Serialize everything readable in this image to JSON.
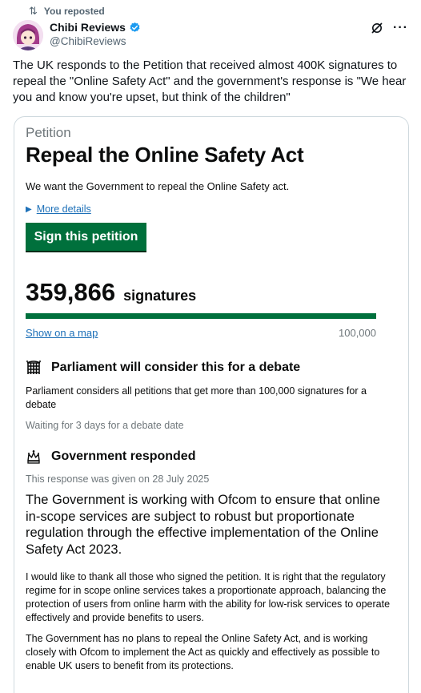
{
  "repost": {
    "icon": "repost-icon",
    "text": "You reposted"
  },
  "author": {
    "name": "Chibi Reviews",
    "handle": "@ChibiReviews",
    "verified": true
  },
  "tweet": {
    "text": "The UK responds to the Petition that received almost 400K signatures to repeal the \"Online Safety Act\" and the government's response is \"We hear you and know you're upset, but think of the children\""
  },
  "petition": {
    "kicker": "Petition",
    "title": "Repeal the Online Safety Act",
    "description": "We want the Government to repeal the Online Safety act.",
    "more_details": "More details",
    "sign_button": "Sign this petition",
    "signature_count": "359,866",
    "signature_label": "signatures",
    "progress_fraction": 1.0,
    "map_link": "Show on a map",
    "threshold": "100,000",
    "parliament": {
      "heading": "Parliament will consider this for a debate",
      "text": "Parliament considers all petitions that get more than 100,000 signatures for a debate",
      "waiting": "Waiting for 3 days for a debate date"
    },
    "government": {
      "heading": "Government responded",
      "date_line": "This response was given on 28 July 2025",
      "summary": "The Government is working with Ofcom to ensure that online in-scope services are subject to robust but proportionate regulation through the effective implementation of the Online Safety Act 2023.",
      "paragraph1": "I would like to thank all those who signed the petition. It is right that the regulatory regime for in scope online services takes a proportionate approach, balancing the protection of users from online harm with the ability for low-risk services to operate effectively and provide benefits to users.",
      "paragraph2": "The Government has no plans to repeal the Online Safety Act, and is working closely with Ofcom to implement the Act as quickly and effectively as possible to enable UK users to benefit from its protections."
    }
  },
  "colors": {
    "gov_green": "#00703c",
    "link_blue": "#1d70b8",
    "x_verified": "#1d9bf0"
  }
}
